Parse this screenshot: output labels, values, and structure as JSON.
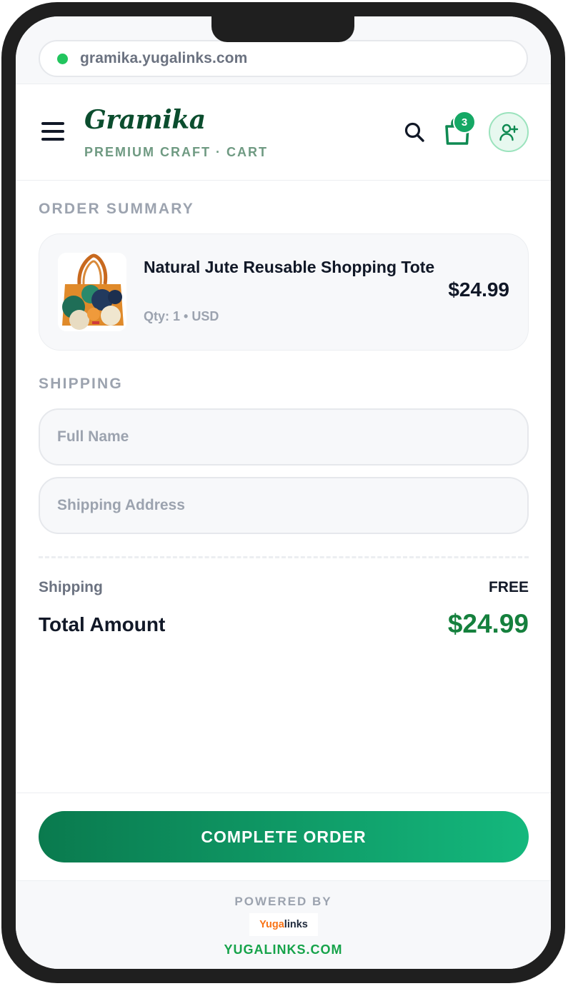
{
  "browser": {
    "url": "gramika.yugalinks.com"
  },
  "header": {
    "brand": "Gramika",
    "subtitle": "PREMIUM CRAFT · CART",
    "cart_count": "3"
  },
  "order": {
    "section_label": "ORDER SUMMARY",
    "item": {
      "name": "Natural Jute Reusable Shopping Tote",
      "meta": "Qty: 1 • USD",
      "price": "$24.99"
    }
  },
  "shipping": {
    "section_label": "SHIPPING",
    "full_name_placeholder": "Full Name",
    "address_placeholder": "Shipping Address"
  },
  "totals": {
    "shipping_label": "Shipping",
    "shipping_value": "FREE",
    "total_label": "Total Amount",
    "total_value": "$24.99"
  },
  "cta": {
    "label": "COMPLETE ORDER"
  },
  "footer": {
    "powered_by": "POWERED BY",
    "logo_part1": "Yuga",
    "logo_part2": "links",
    "link": "YUGALINKS.COM"
  },
  "colors": {
    "brand": "#0b4d2e",
    "accent": "#15a865",
    "total": "#15803d",
    "cta_start": "#0a7a4e",
    "cta_end": "#14b87d"
  }
}
